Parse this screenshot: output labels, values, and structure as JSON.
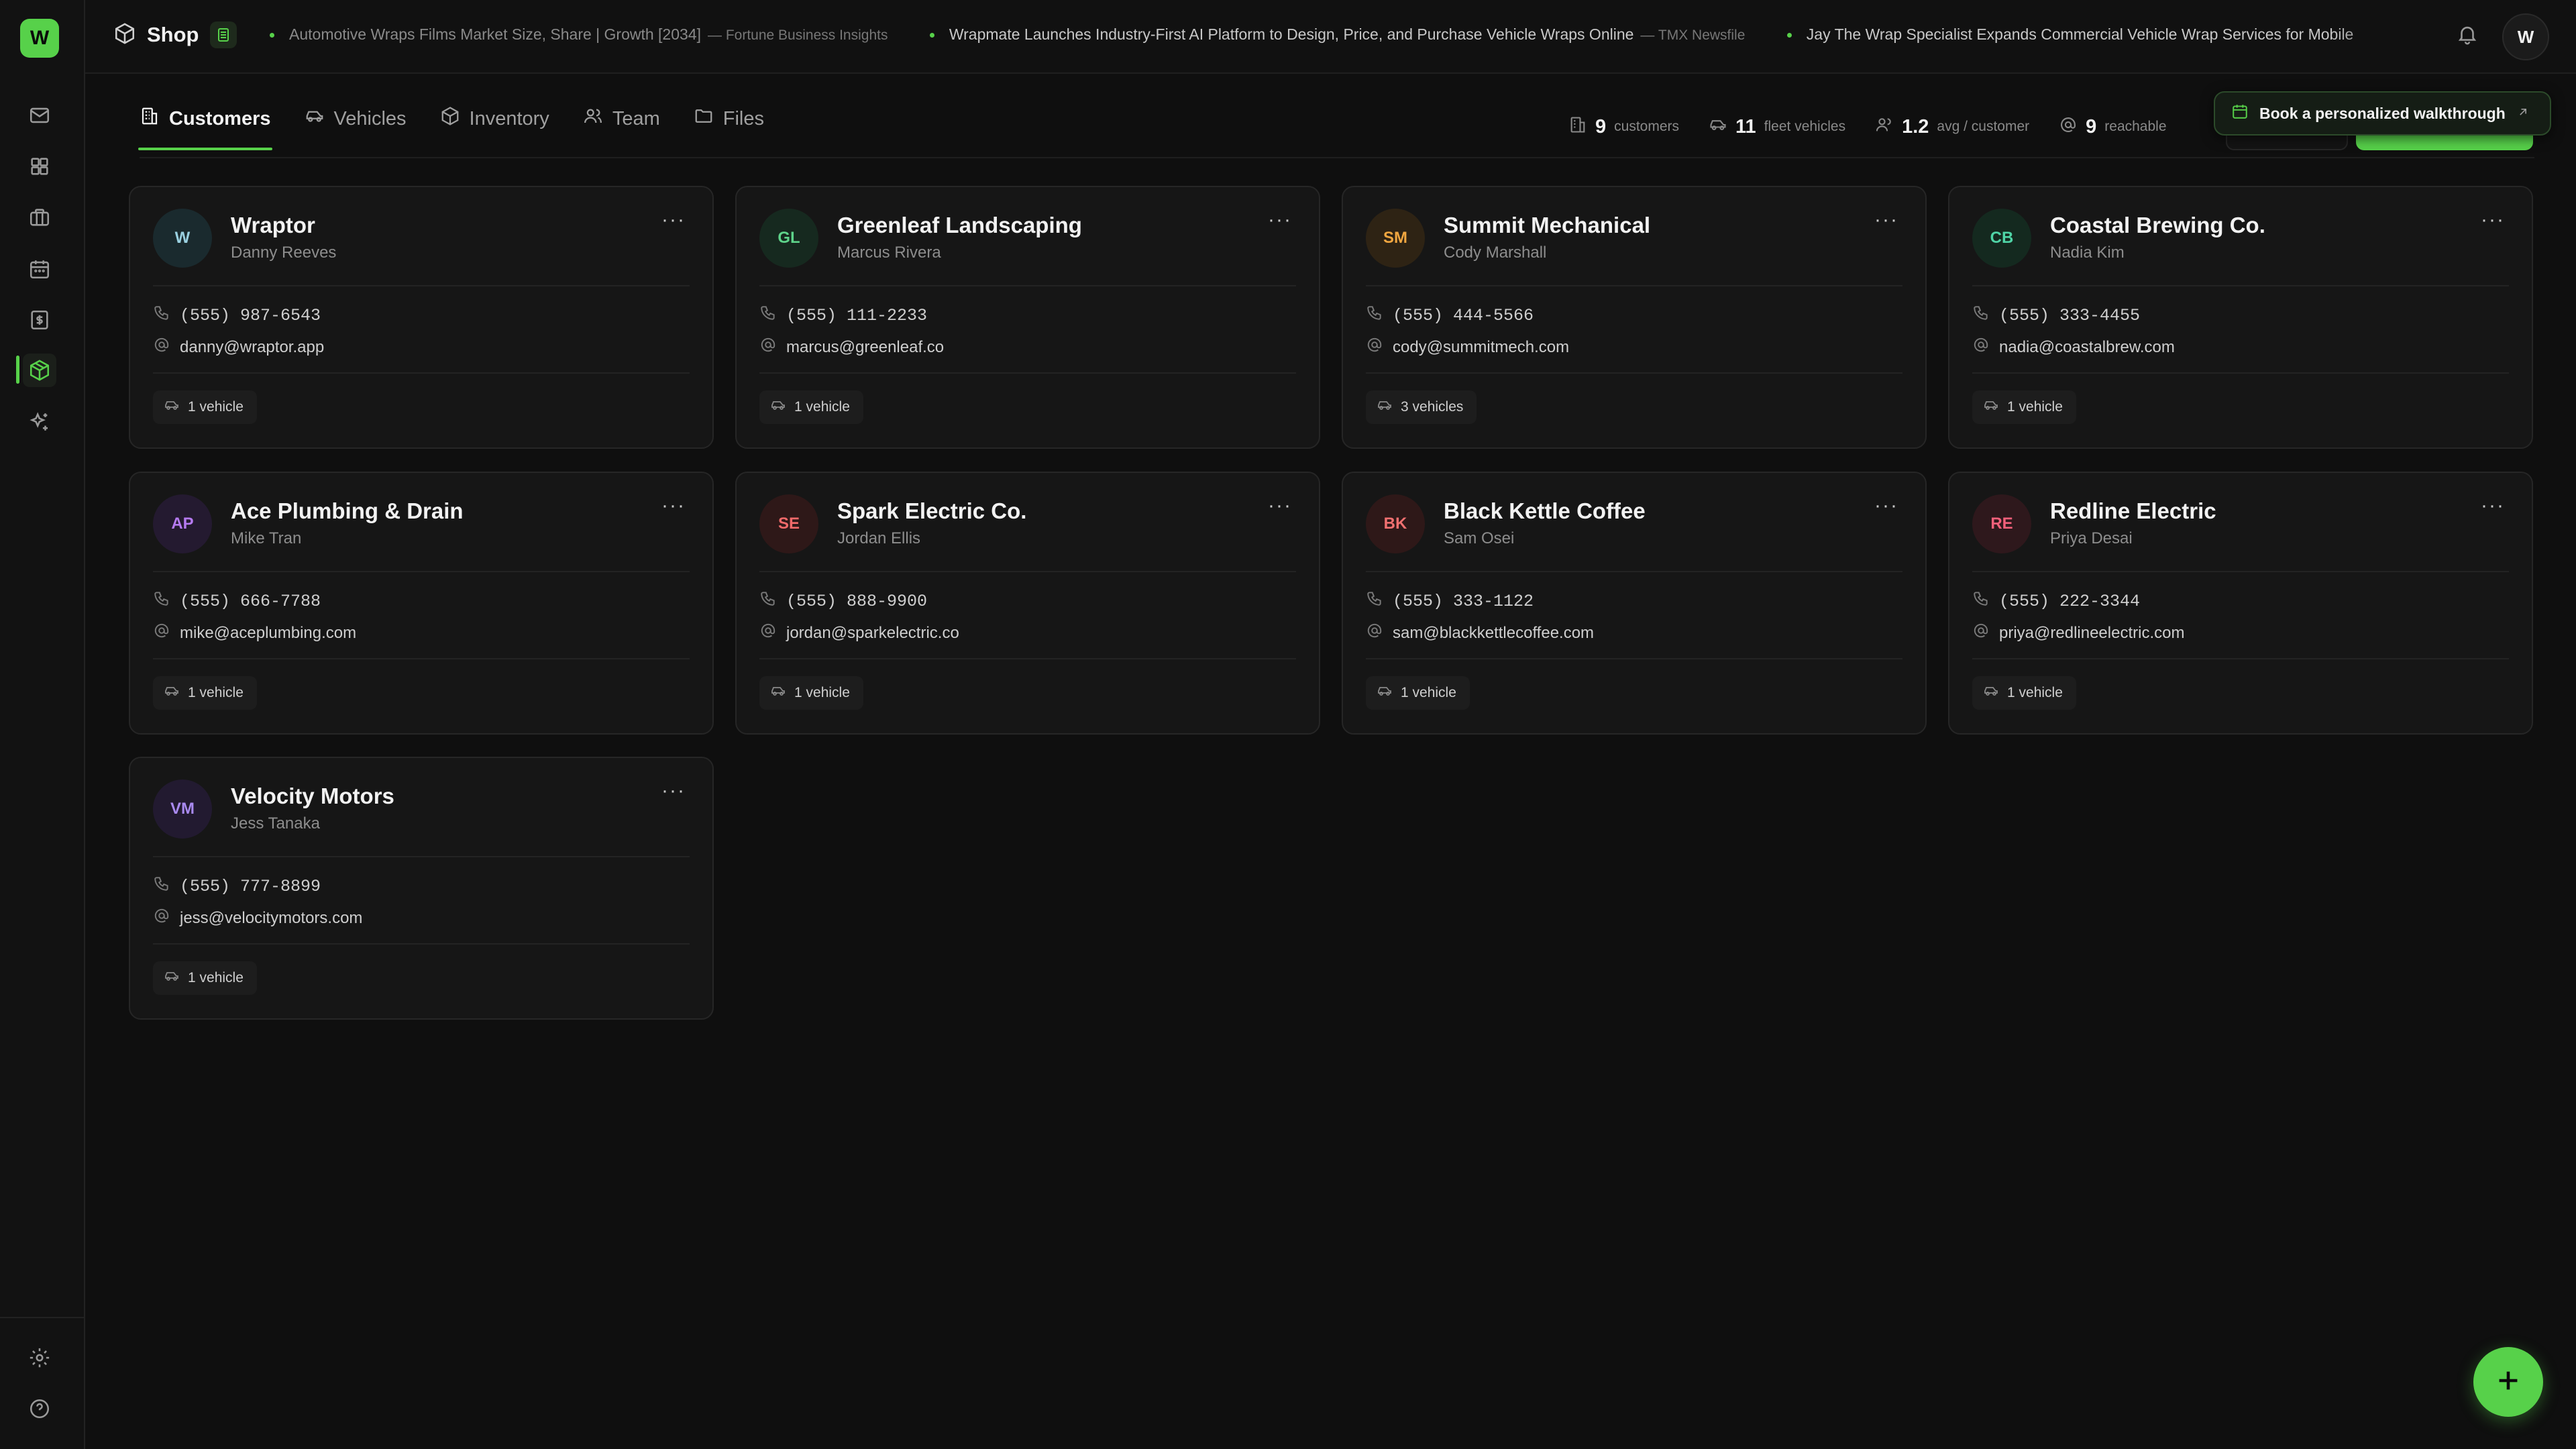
{
  "app": {
    "logo_letter": "W",
    "section_title": "Shop",
    "user_initial": "W"
  },
  "ticker": [
    {
      "headline": "Automotive Wraps Films Market Size, Share | Growth [2034]",
      "source": "— Fortune Business Insights"
    },
    {
      "headline": "Wrapmate Launches Industry-First AI Platform to Design, Price, and Purchase Vehicle Wraps Online",
      "source": "— TMX Newsfile"
    },
    {
      "headline": "Jay The Wrap Specialist Expands Commercial Vehicle Wrap Services for Mobile",
      "source": ""
    }
  ],
  "tabs": [
    {
      "label": "Customers",
      "icon": "building-icon"
    },
    {
      "label": "Vehicles",
      "icon": "car-icon"
    },
    {
      "label": "Inventory",
      "icon": "cube-icon"
    },
    {
      "label": "Team",
      "icon": "users-icon"
    },
    {
      "label": "Files",
      "icon": "folder-icon"
    }
  ],
  "stats": {
    "customers": {
      "value": "9",
      "label": "customers"
    },
    "fleet": {
      "value": "11",
      "label": "fleet vehicles"
    },
    "avg": {
      "value": "1.2",
      "label": "avg / customer"
    },
    "reachable": {
      "value": "9",
      "label": "reachable"
    }
  },
  "walkthrough_label": "Book a personalized walkthrough",
  "customers": [
    {
      "initials": "W",
      "name": "Wraptor",
      "contact": "Danny Reeves",
      "phone": "(555) 987-6543",
      "email": "danny@wraptor.app",
      "vehicles": "1 vehicle",
      "color": "#9ad0e0",
      "bg": "#1a2a2e"
    },
    {
      "initials": "GL",
      "name": "Greenleaf Landscaping",
      "contact": "Marcus Rivera",
      "phone": "(555) 111-2233",
      "email": "marcus@greenleaf.co",
      "vehicles": "1 vehicle",
      "color": "#5ed38a",
      "bg": "#16291f"
    },
    {
      "initials": "SM",
      "name": "Summit Mechanical",
      "contact": "Cody Marshall",
      "phone": "(555) 444-5566",
      "email": "cody@summitmech.com",
      "vehicles": "3 vehicles",
      "color": "#f0a640",
      "bg": "#2e2314"
    },
    {
      "initials": "CB",
      "name": "Coastal Brewing Co.",
      "contact": "Nadia Kim",
      "phone": "(555) 333-4455",
      "email": "nadia@coastalbrew.com",
      "vehicles": "1 vehicle",
      "color": "#4fd4a6",
      "bg": "#14291f"
    },
    {
      "initials": "AP",
      "name": "Ace Plumbing & Drain",
      "contact": "Mike Tran",
      "phone": "(555) 666-7788",
      "email": "mike@aceplumbing.com",
      "vehicles": "1 vehicle",
      "color": "#b57af0",
      "bg": "#241a30"
    },
    {
      "initials": "SE",
      "name": "Spark Electric Co.",
      "contact": "Jordan Ellis",
      "phone": "(555) 888-9900",
      "email": "jordan@sparkelectric.co",
      "vehicles": "1 vehicle",
      "color": "#f06a6a",
      "bg": "#2e1818"
    },
    {
      "initials": "BK",
      "name": "Black Kettle Coffee",
      "contact": "Sam Osei",
      "phone": "(555) 333-1122",
      "email": "sam@blackkettlecoffee.com",
      "vehicles": "1 vehicle",
      "color": "#f07070",
      "bg": "#2e1818"
    },
    {
      "initials": "RE",
      "name": "Redline Electric",
      "contact": "Priya Desai",
      "phone": "(555) 222-3344",
      "email": "priya@redlineelectric.com",
      "vehicles": "1 vehicle",
      "color": "#f0607a",
      "bg": "#2e181c"
    },
    {
      "initials": "VM",
      "name": "Velocity Motors",
      "contact": "Jess Tanaka",
      "phone": "(555) 777-8899",
      "email": "jess@velocitymotors.com",
      "vehicles": "1 vehicle",
      "color": "#a98af0",
      "bg": "#221a30"
    }
  ],
  "colors": {
    "accent": "#57d14a",
    "background": "#0f0f0f",
    "card": "#161616"
  }
}
